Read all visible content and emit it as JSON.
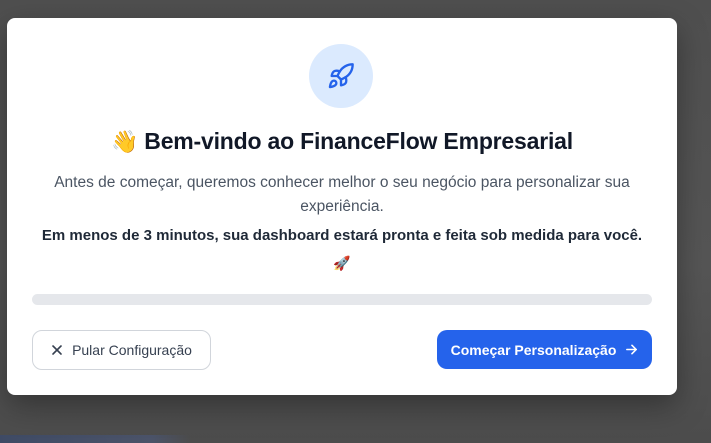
{
  "modal": {
    "icon": "rocket-icon",
    "wave_emoji": "👋",
    "title": "Bem-vindo ao FinanceFlow Empresarial",
    "subtitle": "Antes de começar, queremos conhecer melhor o seu negócio para personalizar sua experiência.",
    "highlight": "Em menos de 3 minutos, sua dashboard estará pronta e feita sob medida para você.",
    "rocket_emoji": "🚀",
    "progress": 0,
    "skip_button": {
      "label": "Pular Configuração",
      "icon": "close-icon"
    },
    "start_button": {
      "label": "Começar Personalização",
      "icon": "arrow-right-icon"
    }
  },
  "colors": {
    "accent": "#2563eb",
    "icon_bg": "#dbeafe",
    "title": "#111827",
    "text": "#4b5563",
    "track": "#e5e7eb",
    "overlay": "#525252"
  }
}
